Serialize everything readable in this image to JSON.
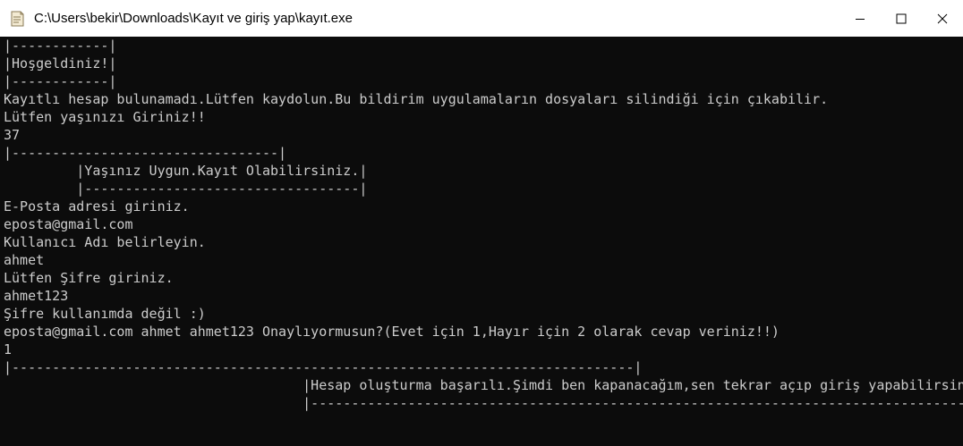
{
  "window": {
    "title": "C:\\Users\\bekir\\Downloads\\Kayıt ve giriş yap\\kayıt.exe",
    "icons": {
      "app": "console-app-icon",
      "minimize": "minimize-icon",
      "maximize": "maximize-icon",
      "close": "close-icon"
    }
  },
  "console": {
    "lines": [
      "|------------|",
      "|Hoşgeldiniz!|",
      "|------------|",
      "Kayıtlı hesap bulunamadı.Lütfen kaydolun.Bu bildirim uygulamaların dosyaları silindiği için çıkabilir.",
      "Lütfen yaşınızı Giriniz!!",
      "37",
      "|---------------------------------|",
      "         |Yaşınız Uygun.Kayıt Olabilirsiniz.|",
      "         |----------------------------------|",
      "E-Posta adresi giriniz.",
      "eposta@gmail.com",
      "Kullanıcı Adı belirleyin.",
      "ahmet",
      "Lütfen Şifre giriniz.",
      "ahmet123",
      "Şifre kullanımda değil :)",
      "eposta@gmail.com ahmet ahmet123 Onaylıyormusun?(Evet için 1,Hayır için 2 olarak cevap veriniz!!)",
      "1",
      "|-----------------------------------------------------------------------------|",
      "                                     |Hesap oluşturma başarılı.Şimdi ben kapanacağım,sen tekrar açıp giriş yapabilirsin☺|",
      "                                     |---------------------------------------------------------------------------------|"
    ]
  }
}
